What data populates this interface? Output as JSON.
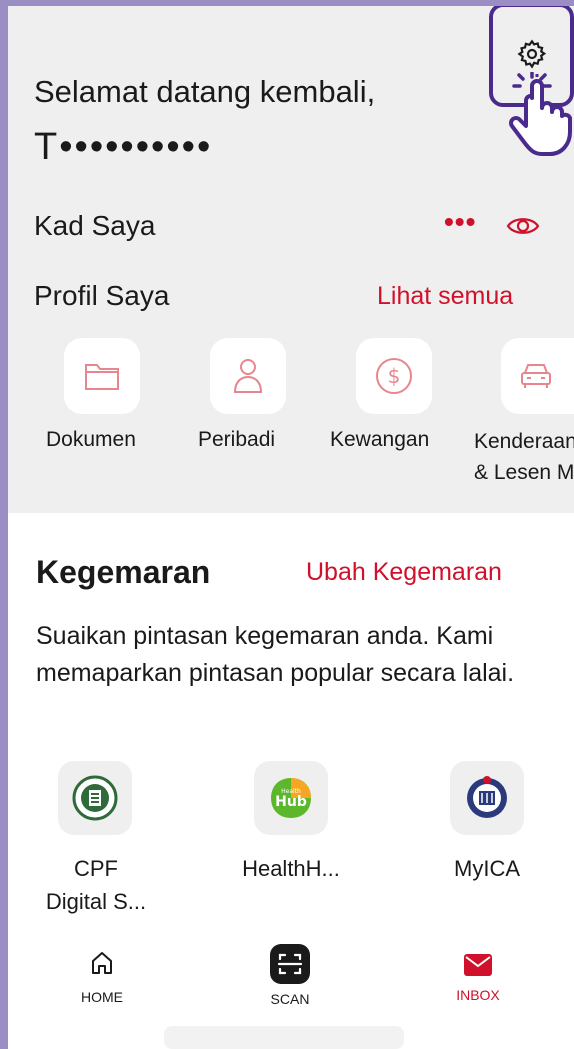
{
  "header": {
    "welcome": "Selamat datang kembali,",
    "masked_name": "T••••••••••"
  },
  "cards": {
    "title": "Kad Saya",
    "more_label": "•••"
  },
  "profile": {
    "title": "Profil Saya",
    "see_all": "Lihat semua",
    "items": [
      {
        "label": "Dokumen",
        "icon": "folder-icon"
      },
      {
        "label": "Peribadi",
        "icon": "person-icon"
      },
      {
        "label": "Kewangan",
        "icon": "dollar-icon"
      },
      {
        "label": "Kenderaan",
        "label_line2": "& Lesen M",
        "icon": "car-icon"
      }
    ]
  },
  "favourites": {
    "title": "Kegemaran",
    "edit": "Ubah Kegemaran",
    "description": "Suaikan pintasan kegemaran anda. Kami memaparkan pintasan popular secara lalai.",
    "items": [
      {
        "label_line1": "CPF",
        "label_line2": "Digital S...",
        "icon": "cpf-logo-icon"
      },
      {
        "label_line1": "HealthH...",
        "icon": "healthhub-logo-icon",
        "logo_text_small": "Health",
        "logo_text": "Hub"
      },
      {
        "label_line1": "MyICA",
        "icon": "ica-logo-icon"
      }
    ]
  },
  "bottom_nav": {
    "items": [
      {
        "label": "HOME",
        "icon": "home-icon"
      },
      {
        "label": "SCAN",
        "icon": "scan-icon"
      },
      {
        "label": "INBOX",
        "icon": "mail-icon",
        "active": true
      }
    ]
  },
  "colors": {
    "accent": "#d0112b",
    "highlight": "#4a2a8c",
    "background_grey": "#efefef"
  }
}
